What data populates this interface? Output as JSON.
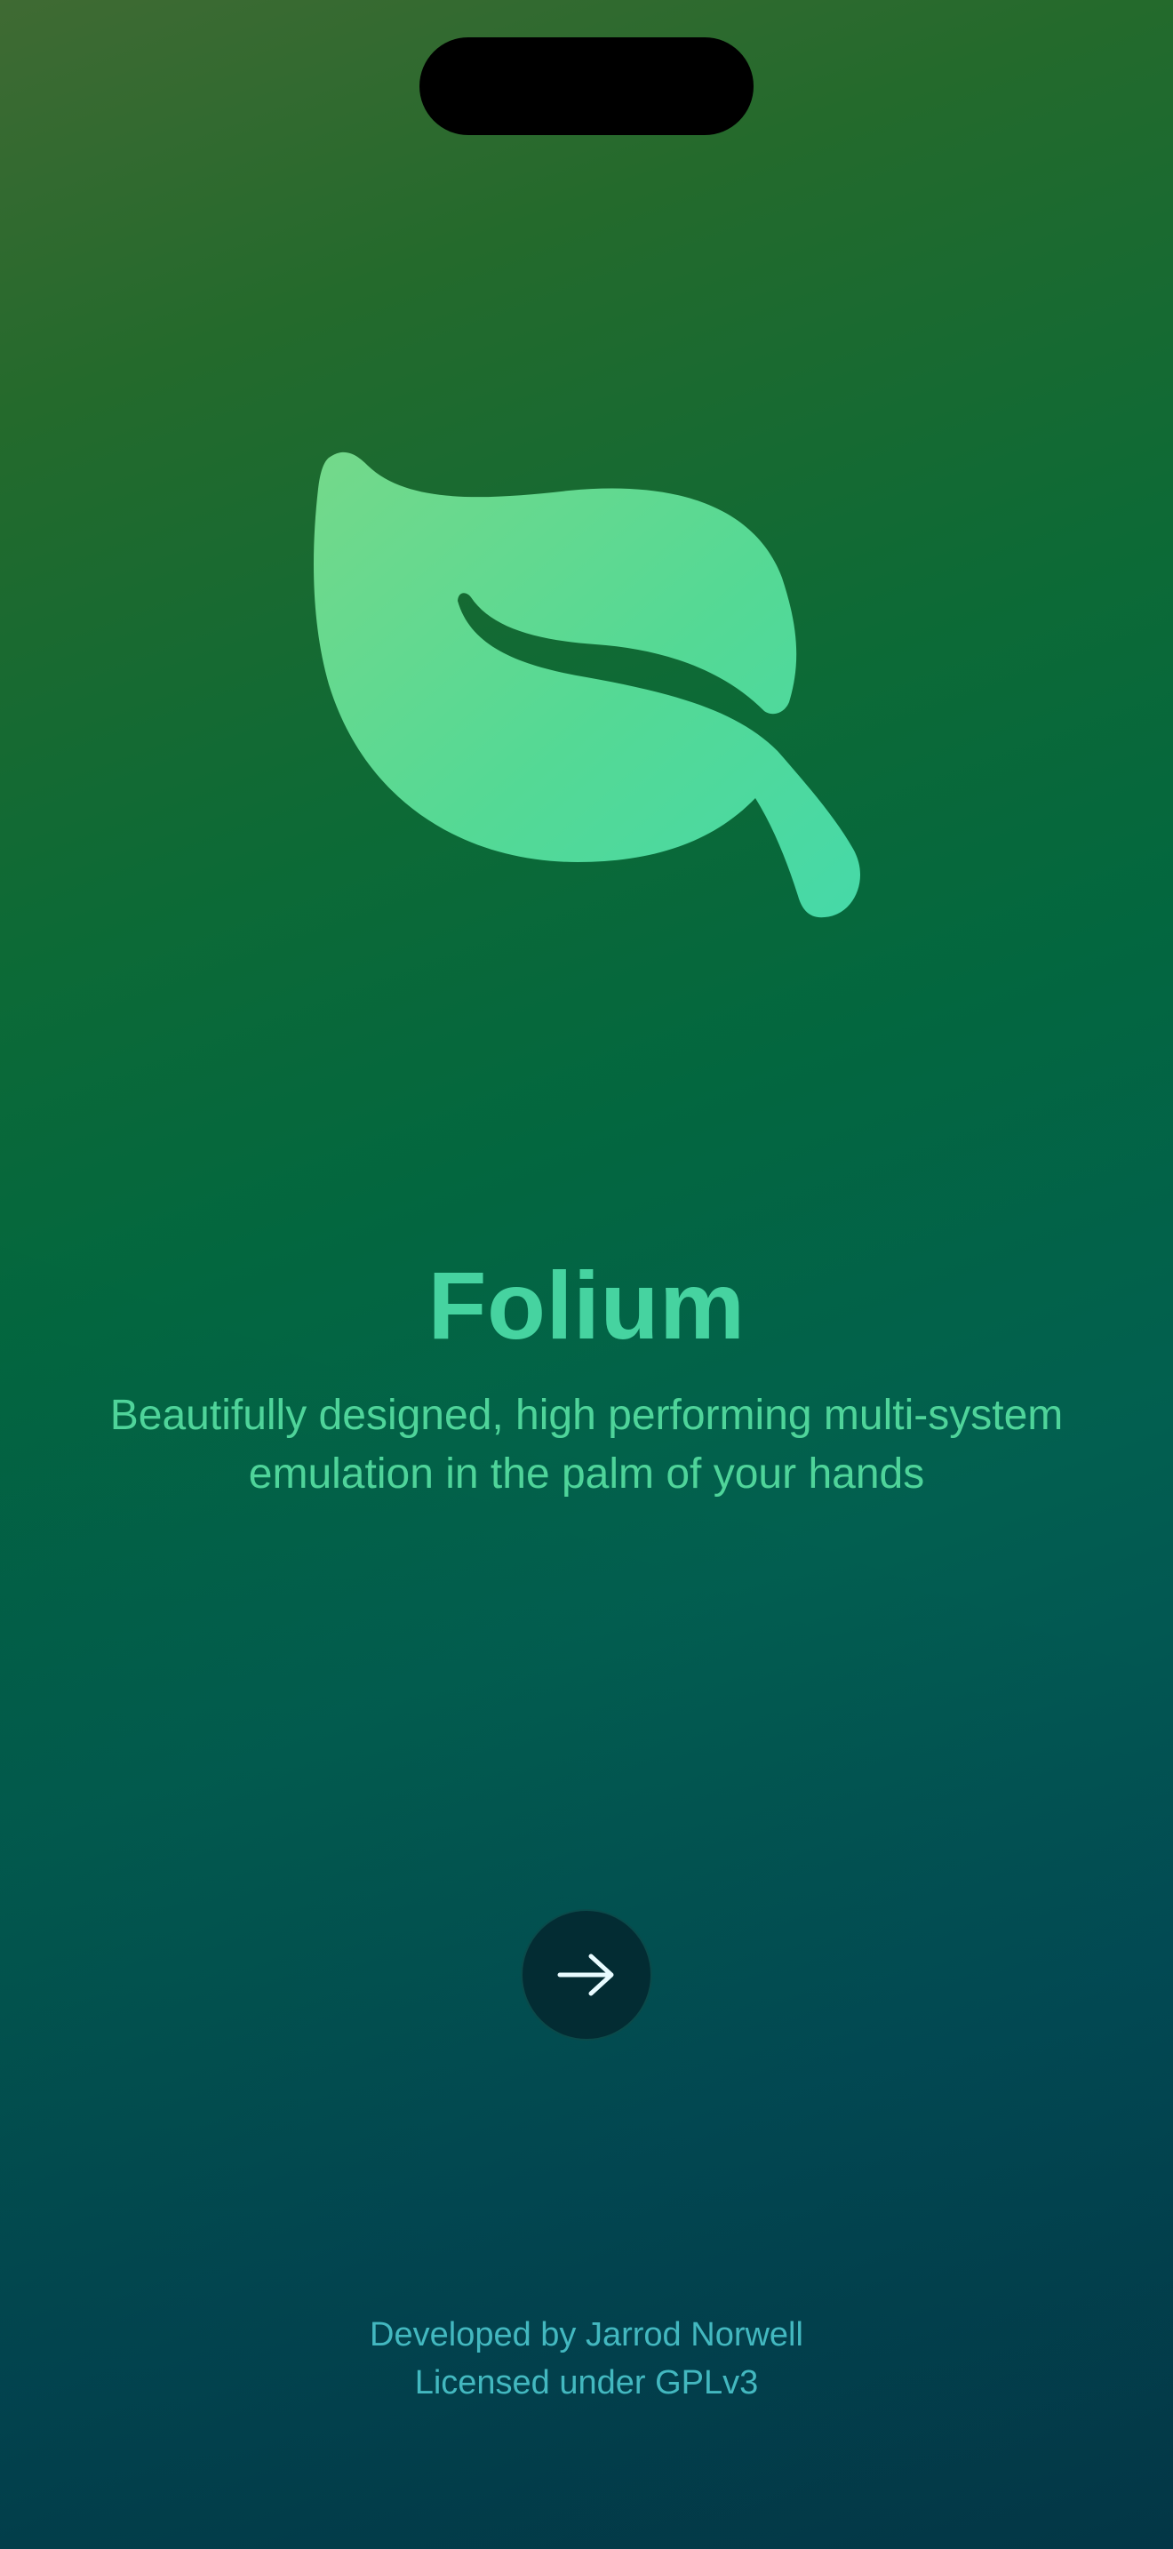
{
  "app": {
    "name": "Folium",
    "tagline": "Beautifully designed, high performing multi-system emulation in the palm of your hands"
  },
  "onboarding": {
    "continue_icon": "arrow-right-icon",
    "logo_icon": "leaf-icon"
  },
  "footer": {
    "developer": "Developed by Jarrod Norwell",
    "license": "Licensed under GPLv3"
  },
  "colors": {
    "accent": "#46d3a0",
    "footer_text": "#43b8c0",
    "button_bg": "#032c33"
  }
}
